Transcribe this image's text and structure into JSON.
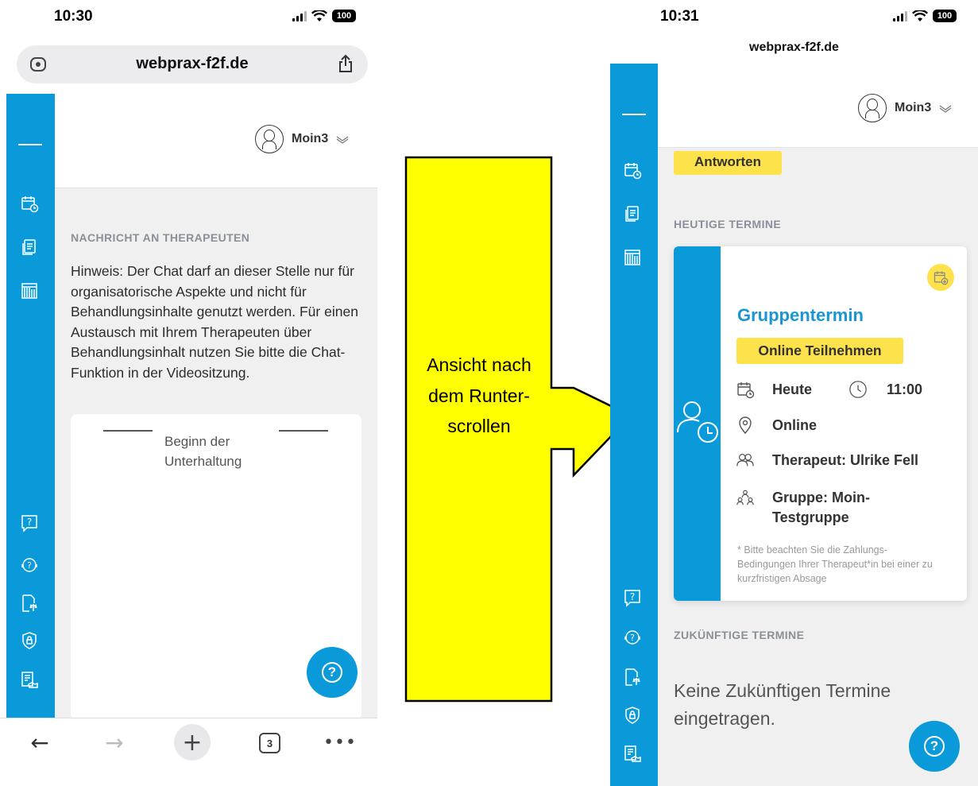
{
  "left_phone": {
    "status": {
      "time": "10:30",
      "battery": "100"
    },
    "browser": {
      "url": "webprax-f2f.de"
    },
    "user_menu": {
      "name": "Moin3"
    },
    "section": {
      "heading": "NACHRICHT AN THERAPEUTEN"
    },
    "hint": "Hinweis: Der Chat darf an dieser Stelle nur für organisatorische Aspekte und nicht für Behandlungsinhalte genutzt werden. Für einen Austausch mit Ihrem Therapeuten über Behandlungsinhalt nutzen Sie bitte die Chat-Funktion in der Videositzung.",
    "chat": {
      "start_label": "Beginn der Unterhaltung"
    },
    "toolbar": {
      "tabs_count": "3"
    }
  },
  "arrow": {
    "label": "Ansicht nach dem Runter-scrollen"
  },
  "right_phone": {
    "status": {
      "time": "10:31",
      "battery": "100"
    },
    "domain": "webprax-f2f.de",
    "user_menu": {
      "name": "Moin3"
    },
    "answer_button": "Antworten",
    "today_heading": "HEUTIGE TERMINE",
    "appointment": {
      "title": "Gruppentermin",
      "join_button": "Online Teilnehmen",
      "date": "Heute",
      "time": "11:00",
      "location": "Online",
      "therapist": "Therapeut: Ulrike Fell",
      "group": "Gruppe: Moin-Testgruppe",
      "note": "* Bitte beachten Sie die Zahlungs-Bedingungen Ihrer Therapeut*in bei einer zu kurzfristigen Absage"
    },
    "future_heading": "ZUKÜNFTIGE TERMINE",
    "empty_message": "Keine Zukünftigen Termine eingetragen."
  },
  "colors": {
    "brand_blue": "#0a9ad9",
    "accent_yellow": "#fde24c",
    "arrow_yellow": "#ffff00"
  }
}
